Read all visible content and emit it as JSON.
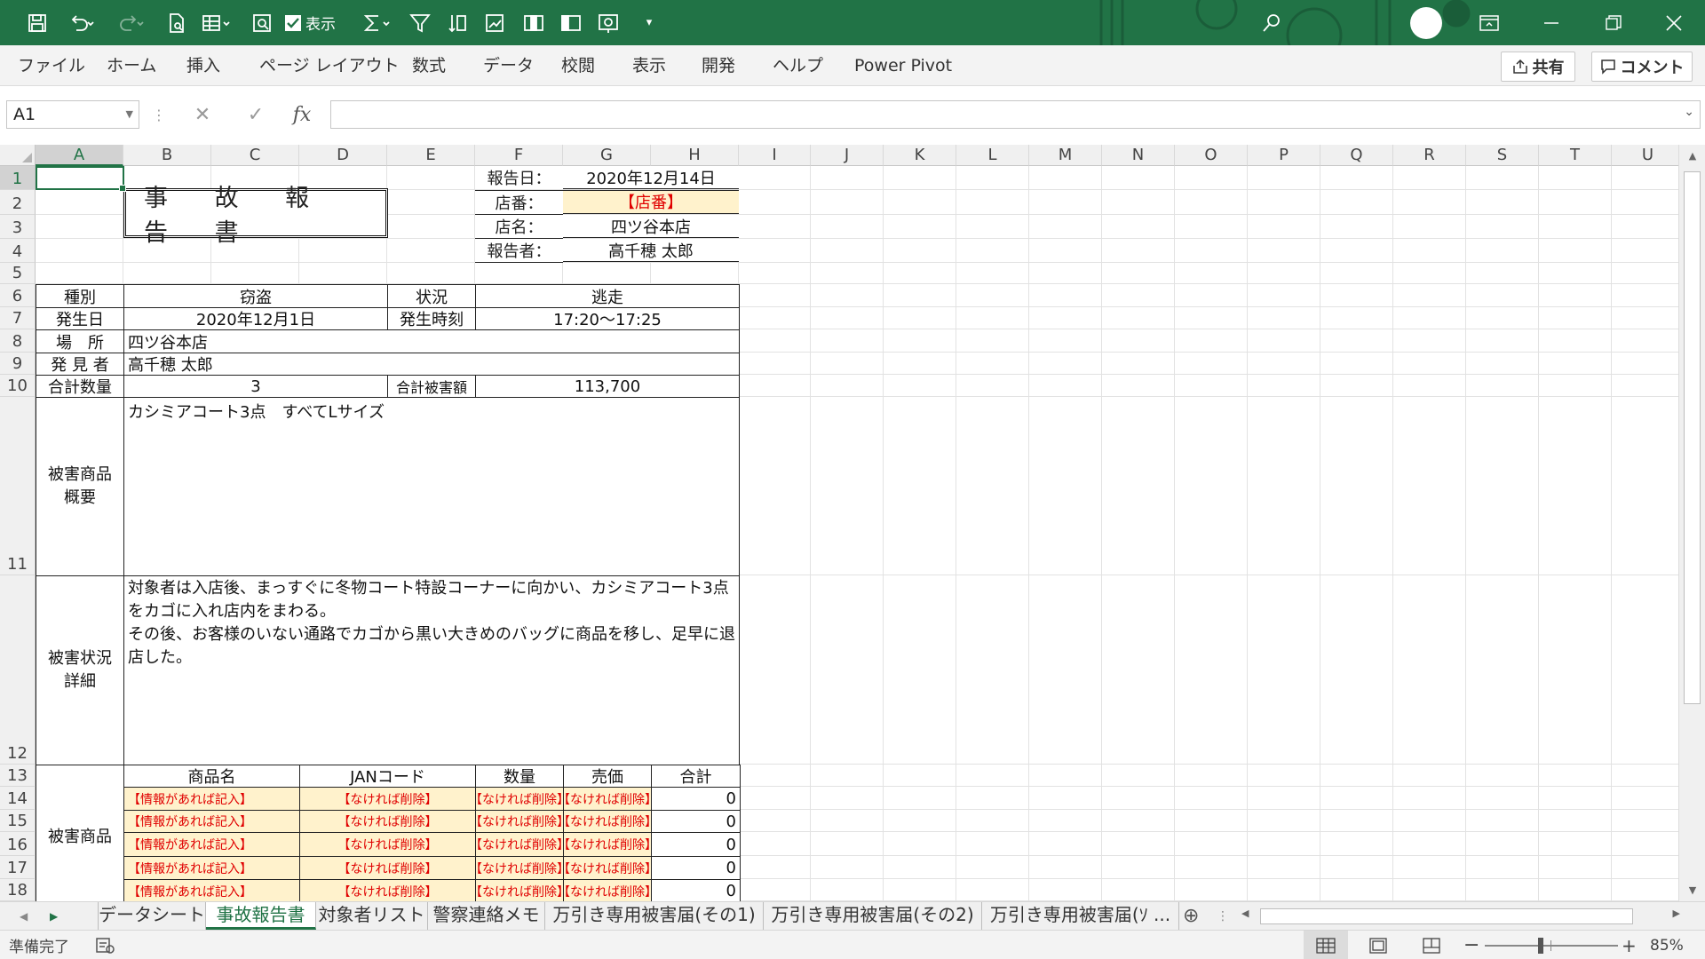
{
  "titlebar": {
    "qa_display_label": "表示",
    "icons": [
      "save-icon",
      "undo-icon",
      "redo-icon",
      "print-preview-icon",
      "table-icon",
      "find-icon",
      "checkbox-icon",
      "sum-icon",
      "filter-icon",
      "sort-icon",
      "chart-icon",
      "column-icon",
      "freeze-icon",
      "zoom-icon",
      "customize-icon"
    ],
    "window_icons": [
      "search-icon",
      "account-avatar",
      "ribbon-display-icon",
      "minimize-icon",
      "restore-icon",
      "close-icon"
    ]
  },
  "menu": {
    "items": [
      "ファイル",
      "ホーム",
      "挿入",
      "ページ レイアウト",
      "数式",
      "データ",
      "校閲",
      "表示",
      "開発",
      "ヘルプ",
      "Power Pivot"
    ],
    "share_label": "共有",
    "comment_label": "コメント"
  },
  "formula_bar": {
    "name_box": "A1",
    "fx_label": "fx",
    "formula": ""
  },
  "columns": [
    "A",
    "B",
    "C",
    "D",
    "E",
    "F",
    "G",
    "H",
    "I",
    "J",
    "K",
    "L",
    "M",
    "N",
    "O",
    "P",
    "Q",
    "R",
    "S",
    "T",
    "U"
  ],
  "rows": [
    "1",
    "2",
    "3",
    "4",
    "5",
    "6",
    "7",
    "8",
    "9",
    "10",
    "11",
    "12",
    "13",
    "14",
    "15",
    "16",
    "17",
    "18"
  ],
  "report": {
    "title": "事 故 報 告 書",
    "report_date_label": "報告日：",
    "report_date": "2020年12月14日",
    "store_no_label": "店番：",
    "store_no": "【店番】",
    "store_name_label": "店名：",
    "store_name": "四ツ谷本店",
    "reporter_label": "報告者：",
    "reporter": "高千穂 太郎",
    "type_label": "種別",
    "type": "窃盗",
    "status_label": "状況",
    "status": "逃走",
    "date_label": "発生日",
    "date": "2020年12月1日",
    "time_label": "発生時刻",
    "time": "17:20～17:25",
    "place_label": "場　所",
    "place": "四ツ谷本店",
    "finder_label": "発 見 者",
    "finder": "高千穂 太郎",
    "qty_label": "合計数量",
    "qty": "3",
    "damage_label": "合計被害額",
    "damage": "113,700",
    "summary_label_1": "被害商品",
    "summary_label_2": "概要",
    "summary": "カシミアコート3点　すべてLサイズ",
    "detail_label_1": "被害状況",
    "detail_label_2": "詳細",
    "detail_line1": "対象者は入店後、まっすぐに冬物コート特設コーナーに向かい、カシミアコート3点をカゴに入れ店内をまわる。",
    "detail_line2": "その後、お客様のいない通路でカゴから黒い大きめのバッグに商品を移し、足早に退店した。",
    "items_label": "被害商品",
    "items_headers": [
      "商品名",
      "JANコード",
      "数量",
      "売価",
      "合計"
    ],
    "items_rows": [
      [
        "【情報があれば記入】",
        "【なければ削除】",
        "【なければ削除】",
        "【なければ削除】",
        "0"
      ],
      [
        "【情報があれば記入】",
        "【なければ削除】",
        "【なければ削除】",
        "【なければ削除】",
        "0"
      ],
      [
        "【情報があれば記入】",
        "【なければ削除】",
        "【なければ削除】",
        "【なければ削除】",
        "0"
      ],
      [
        "【情報があれば記入】",
        "【なければ削除】",
        "【なければ削除】",
        "【なければ削除】",
        "0"
      ],
      [
        "【情報があれば記入】",
        "【なければ削除】",
        "【なければ削除】",
        "【なければ削除】",
        "0"
      ]
    ]
  },
  "sheets": {
    "tabs": [
      "データシート",
      "事故報告書",
      "対象者リスト",
      "警察連絡メモ",
      "万引き専用被害届(その1)",
      "万引き専用被害届(その2)",
      "万引き専用被害届(ｿ ..."
    ],
    "active": "事故報告書"
  },
  "status": {
    "ready": "準備完了",
    "zoom": "85%",
    "zoom_level": 0.85
  },
  "colors": {
    "accent": "#217346",
    "input_fill": "#fff2cc",
    "placeholder_text": "#e00000"
  }
}
